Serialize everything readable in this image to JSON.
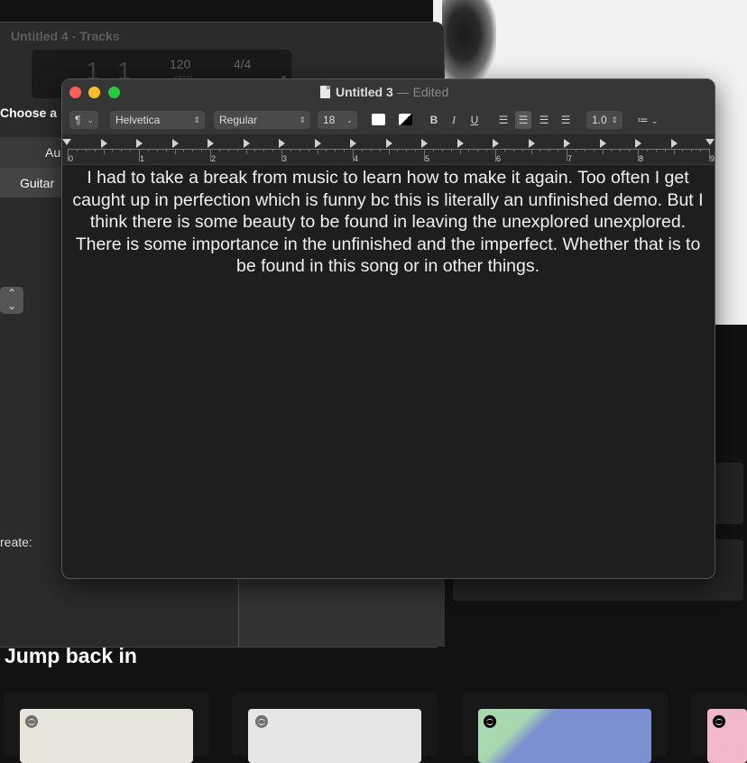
{
  "background": {
    "spotify": {
      "section_title": "Jump back in",
      "cards": [
        {
          "art_color": "#e7e4dc"
        },
        {
          "art_color": "#e6e6e6"
        },
        {
          "art_color": "#7b90d0"
        },
        {
          "art_color": "#f0b8c8"
        }
      ]
    }
  },
  "logic": {
    "title": "Untitled 4 - Tracks",
    "lcd": {
      "bar": "1",
      "beat": "1",
      "tempo": "120",
      "tempo_label": "KEEP",
      "signature": "4/4"
    },
    "chooser_label": "Choose a",
    "button_audio": "Au",
    "button_guitar": "Guitar",
    "create_label": "reate:"
  },
  "textedit": {
    "title": "Untitled 3",
    "title_separator": "—",
    "status": "Edited",
    "toolbar": {
      "paragraph_icon": "¶",
      "font_family": "Helvetica",
      "font_style": "Regular",
      "font_size": "18",
      "bold": "B",
      "italic": "I",
      "underline": "U",
      "line_spacing": "1.0",
      "list_icon": "≔",
      "text_color": "#ffffff",
      "highlight_color": "#000000"
    },
    "ruler": {
      "numbers": [
        "0",
        "1",
        "2",
        "3",
        "4",
        "5",
        "6",
        "7",
        "8",
        "9"
      ]
    },
    "body": "I had to take a break from music to learn how to make it again. Too often I get caught up in perfection which is funny bc this is literally an unfinished demo. But I think there is some beauty to be found in leaving the unexplored unexplored. There is some importance in the unfinished and the imperfect. Whether that is to be found in this song or in other things."
  },
  "colors": {
    "close": "#fe5f57",
    "minimize": "#febc2e",
    "zoom": "#28c840"
  }
}
